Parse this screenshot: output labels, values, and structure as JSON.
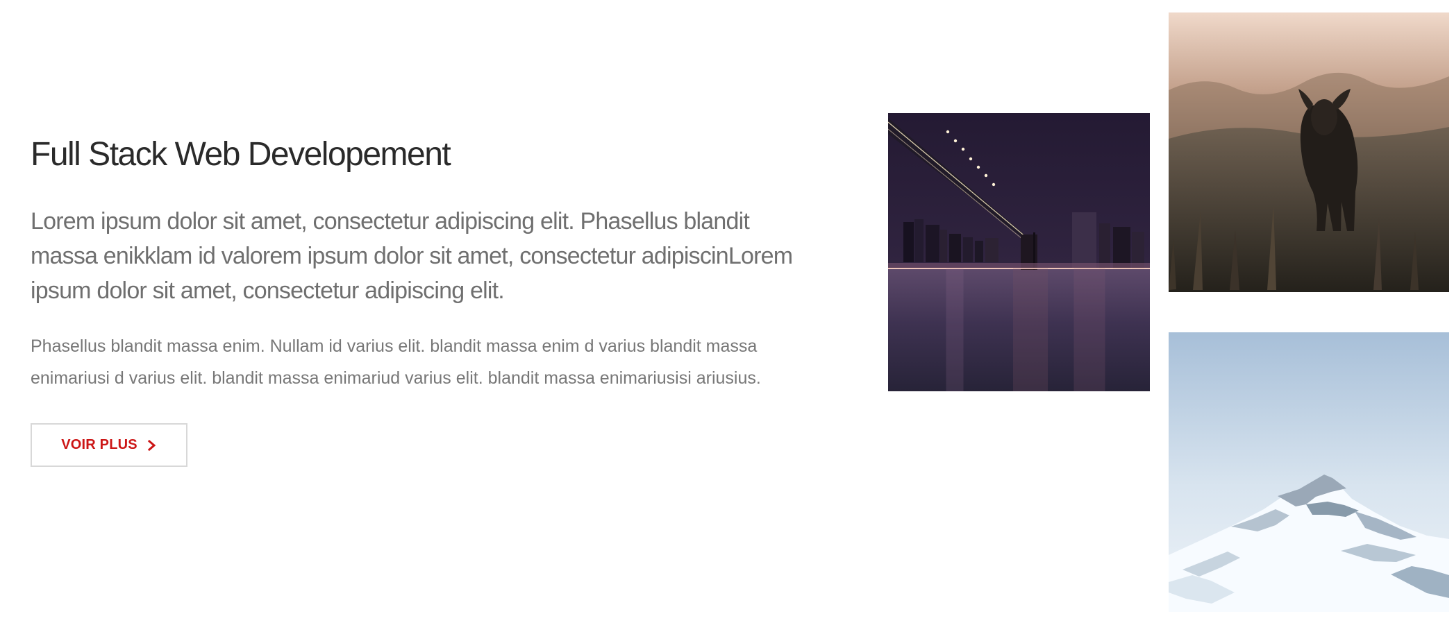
{
  "hero": {
    "title": "Full Stack Web Developement",
    "lead": "Lorem ipsum dolor sit amet, consectetur adipiscing elit. Phasellus blandit massa enikklam id valorem ipsum dolor sit amet, consectetur adipiscinLorem ipsum dolor sit amet, consectetur adipiscing elit.",
    "body": "Phasellus blandit massa enim. Nullam id varius elit. blandit massa enim d varius blandit massa enimariusi d varius elit. blandit massa enimariud varius elit. blandit massa enimariusisi ariusius.",
    "cta_label": "VOIR PLUS",
    "cta_icon": "chevron-right-icon"
  },
  "colors": {
    "accent": "#cc1616",
    "title": "#2a2a2a",
    "text": "#6f6f6f",
    "border": "#d8d8d8",
    "background": "#ffffff"
  },
  "gallery": {
    "images": [
      {
        "name": "city-bridge-night"
      },
      {
        "name": "deer-in-field"
      },
      {
        "name": "snowy-mountain"
      }
    ]
  }
}
